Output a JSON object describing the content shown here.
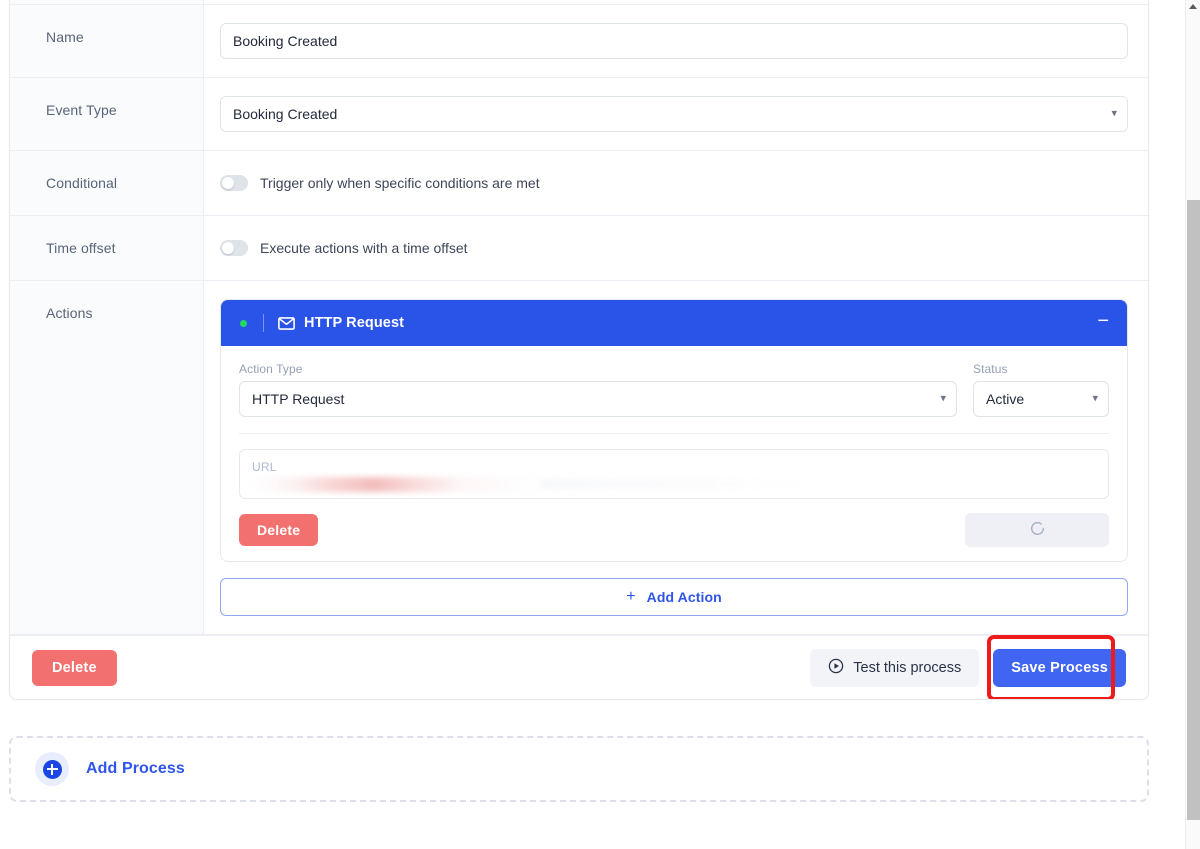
{
  "process_form": {
    "rows": [
      {
        "label": "Name",
        "type": "text"
      },
      {
        "label": "Event Type",
        "type": "select"
      },
      {
        "label": "Conditional",
        "type": "toggle"
      },
      {
        "label": "Time offset",
        "type": "toggle"
      },
      {
        "label": "Actions",
        "type": "actions"
      }
    ],
    "name_field": {
      "label": "Name",
      "value": "Booking Created",
      "placeholder": "Name"
    },
    "event_type_field": {
      "label": "Event Type",
      "value": "Booking Created"
    },
    "conditional_field": {
      "label": "Conditional",
      "toggle_text": "Trigger only when specific conditions are met",
      "enabled": "off"
    },
    "time_offset_field": {
      "label": "Time offset",
      "toggle_text": "Execute actions with a time offset",
      "enabled": "off"
    },
    "actions_field": {
      "label": "Actions"
    }
  },
  "action_card": {
    "header": {
      "title": "HTTP Request",
      "icon": "envelope-icon",
      "status_dot_color": "#22d85e",
      "collapse_glyph": "−",
      "background_color": "#2a53e8"
    },
    "action_type": {
      "label": "Action Type",
      "value": "HTTP Request"
    },
    "status": {
      "label": "Status",
      "value": "Active"
    },
    "url": {
      "label": "URL",
      "value": "",
      "redacted": "true"
    },
    "delete_button": "Delete",
    "loading_button": {
      "label": "",
      "icon": "spinner-icon",
      "disabled": "true"
    },
    "add_action_button": {
      "label": "Add Action",
      "plus_glyph": "+"
    }
  },
  "card_footer": {
    "delete_button": "Delete",
    "test_button": {
      "label": "Test this process",
      "icon": "play-circle-icon"
    },
    "save_button": {
      "label": "Save Process",
      "color": "#4065f0",
      "highlight_color": "#ef1a1a"
    }
  },
  "add_process": {
    "label": "Add Process",
    "icon": "plus-circle-icon",
    "accent_color": "#2f55ea"
  },
  "scrollbar": {
    "orientation": "vertical",
    "arrow_up": "▲"
  }
}
